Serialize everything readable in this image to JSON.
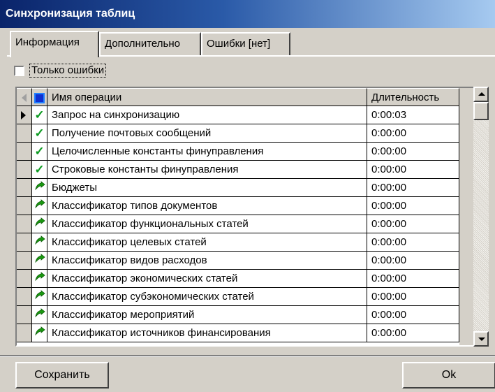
{
  "window": {
    "title": "Синхронизация таблиц"
  },
  "tabs": [
    {
      "label": "Информация",
      "active": true
    },
    {
      "label": "Дополнительно",
      "active": false
    },
    {
      "label": "Ошибки [нет]",
      "active": false
    }
  ],
  "filter": {
    "label": "Только ошибки",
    "checked": false
  },
  "grid": {
    "columns": {
      "name": "Имя операции",
      "duration": "Длительность"
    },
    "rows": [
      {
        "status": "done-check-icon",
        "name": "Запрос на синхронизацию",
        "duration": "0:00:03",
        "current": true
      },
      {
        "status": "done-check-icon",
        "name": "Получение почтовых сообщений",
        "duration": "0:00:00"
      },
      {
        "status": "done-check-icon",
        "name": "Целочисленные константы финуправления",
        "duration": "0:00:00"
      },
      {
        "status": "done-check-icon",
        "name": "Строковые константы финуправления",
        "duration": "0:00:00"
      },
      {
        "status": "tree-leaf-icon",
        "name": "Бюджеты",
        "duration": "0:00:00"
      },
      {
        "status": "tree-leaf-icon",
        "name": "Классификатор типов документов",
        "duration": "0:00:00"
      },
      {
        "status": "tree-leaf-icon",
        "name": "Классификатор функциональных статей",
        "duration": "0:00:00"
      },
      {
        "status": "tree-leaf-icon",
        "name": "Классификатор целевых статей",
        "duration": "0:00:00"
      },
      {
        "status": "tree-leaf-icon",
        "name": "Классификатор видов расходов",
        "duration": "0:00:00"
      },
      {
        "status": "tree-leaf-icon",
        "name": "Классификатор экономических статей",
        "duration": "0:00:00"
      },
      {
        "status": "tree-leaf-icon",
        "name": "Классификатор субэкономических статей",
        "duration": "0:00:00"
      },
      {
        "status": "tree-leaf-icon",
        "name": "Классификатор мероприятий",
        "duration": "0:00:00"
      },
      {
        "status": "tree-leaf-icon",
        "name": "Классификатор источников финансирования",
        "duration": "0:00:00"
      }
    ]
  },
  "buttons": {
    "save": "Сохранить",
    "ok": "Ok"
  },
  "colors": {
    "title_start": "#0a246a",
    "check": "#0c9a20",
    "leaf": "#1a9a10"
  }
}
